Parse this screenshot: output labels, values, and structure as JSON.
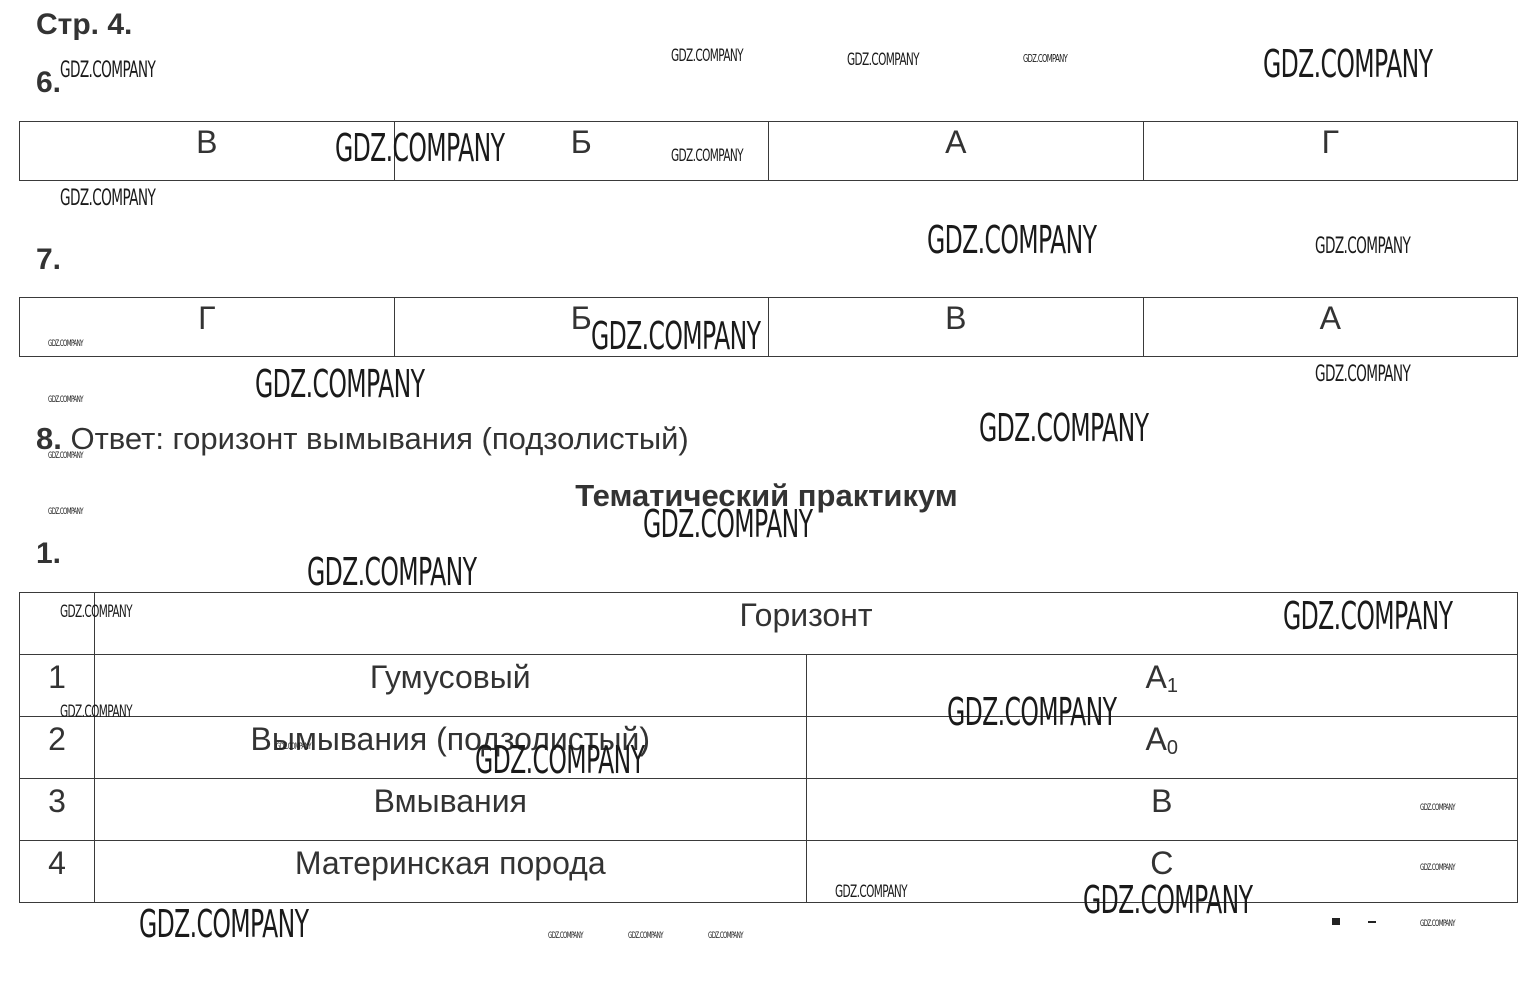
{
  "page_header": "Стр. 4.",
  "task6": {
    "number": "6.",
    "cells": [
      "В",
      "Б",
      "А",
      "Г"
    ]
  },
  "task7": {
    "number": "7.",
    "cells": [
      "Г",
      "Б",
      "В",
      "А"
    ]
  },
  "task8": {
    "number": "8.",
    "text": "Ответ: горизонт вымывания (подзолистый)"
  },
  "section_title": "Тематический практикум",
  "practicum1": {
    "number": "1.",
    "header": "Горизонт",
    "rows": [
      {
        "idx": "1",
        "name": "Гумусовый",
        "code": "A",
        "code_sub": "1"
      },
      {
        "idx": "2",
        "name": "Вымывания (подзолистый)",
        "code": "A",
        "code_sub": "0"
      },
      {
        "idx": "3",
        "name": "Вмывания",
        "code": "B",
        "code_sub": ""
      },
      {
        "idx": "4",
        "name": "Материнская порода",
        "code": "C",
        "code_sub": ""
      }
    ]
  },
  "watermark": "GDZ.COMPANY"
}
